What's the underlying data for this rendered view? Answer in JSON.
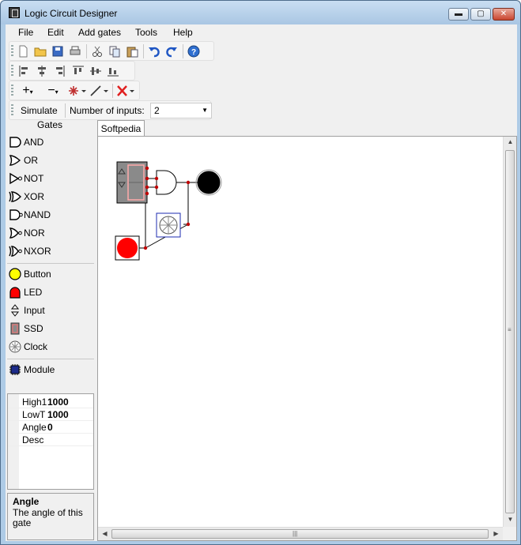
{
  "window": {
    "title": "Logic Circuit Designer",
    "min_glyph": "▬",
    "max_glyph": "▢",
    "close_glyph": "✕"
  },
  "menu": [
    "File",
    "Edit",
    "Add gates",
    "Tools",
    "Help"
  ],
  "simulate": {
    "button_label": "Simulate",
    "inputs_label": "Number of inputs:",
    "inputs_value": "2"
  },
  "gates_panel": {
    "header": "Gates",
    "gates": [
      "AND",
      "OR",
      "NOT",
      "XOR",
      "NAND",
      "NOR",
      "NXOR"
    ],
    "io": [
      "Button",
      "LED",
      "Input",
      "SSD",
      "Clock"
    ],
    "modules": [
      "Module"
    ]
  },
  "properties": [
    {
      "name": "High1",
      "value": "1000"
    },
    {
      "name": "LowT",
      "value": "1000"
    },
    {
      "name": "Angle",
      "value": "0"
    },
    {
      "name": "Desc",
      "value": ""
    }
  ],
  "help": {
    "title": "Angle",
    "text": "The angle of this gate"
  },
  "document": {
    "tab_label": "Softpedia"
  },
  "colors": {
    "accent": "#c00000",
    "led_on": "#ff0000",
    "led_off": "#000000",
    "button_fill": "#ffff00"
  }
}
